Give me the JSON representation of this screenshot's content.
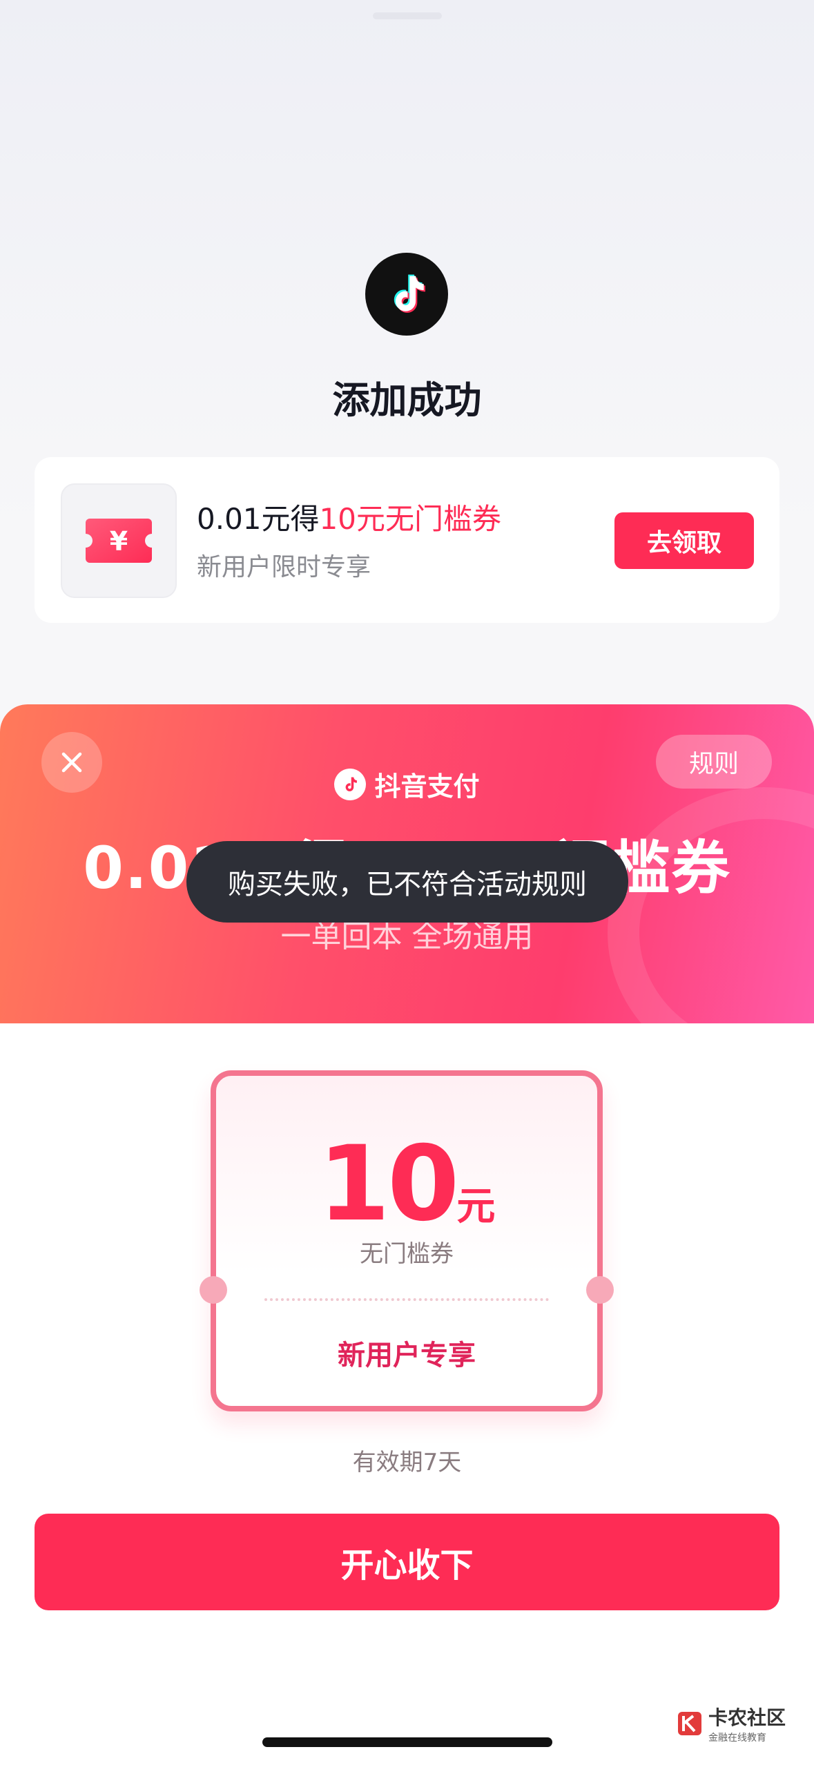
{
  "success": {
    "title": "添加成功"
  },
  "offer_card": {
    "title_prefix": "0.01元得",
    "title_highlight": "10元无门槛券",
    "subtitle": "新用户限时专享",
    "claim_label": "去领取",
    "icon": "yuan-ticket-icon"
  },
  "modal": {
    "close_icon": "close-icon",
    "rules_label": "规则",
    "brand_name": "抖音支付",
    "headline": "0.01元得10元无门槛券",
    "subheadline": "一单回本 全场通用",
    "coupon": {
      "amount": "10",
      "unit": "元",
      "type": "无门槛券",
      "tag": "新用户专享"
    },
    "validity": "有效期7天",
    "accept_label": "开心收下"
  },
  "toast": {
    "message": "购买失败，已不符合活动规则"
  },
  "watermark": {
    "title": "卡农社区",
    "subtitle": "金融在线教育"
  },
  "colors": {
    "accent": "#fe2c55",
    "toast_bg": "#2d2f37"
  }
}
